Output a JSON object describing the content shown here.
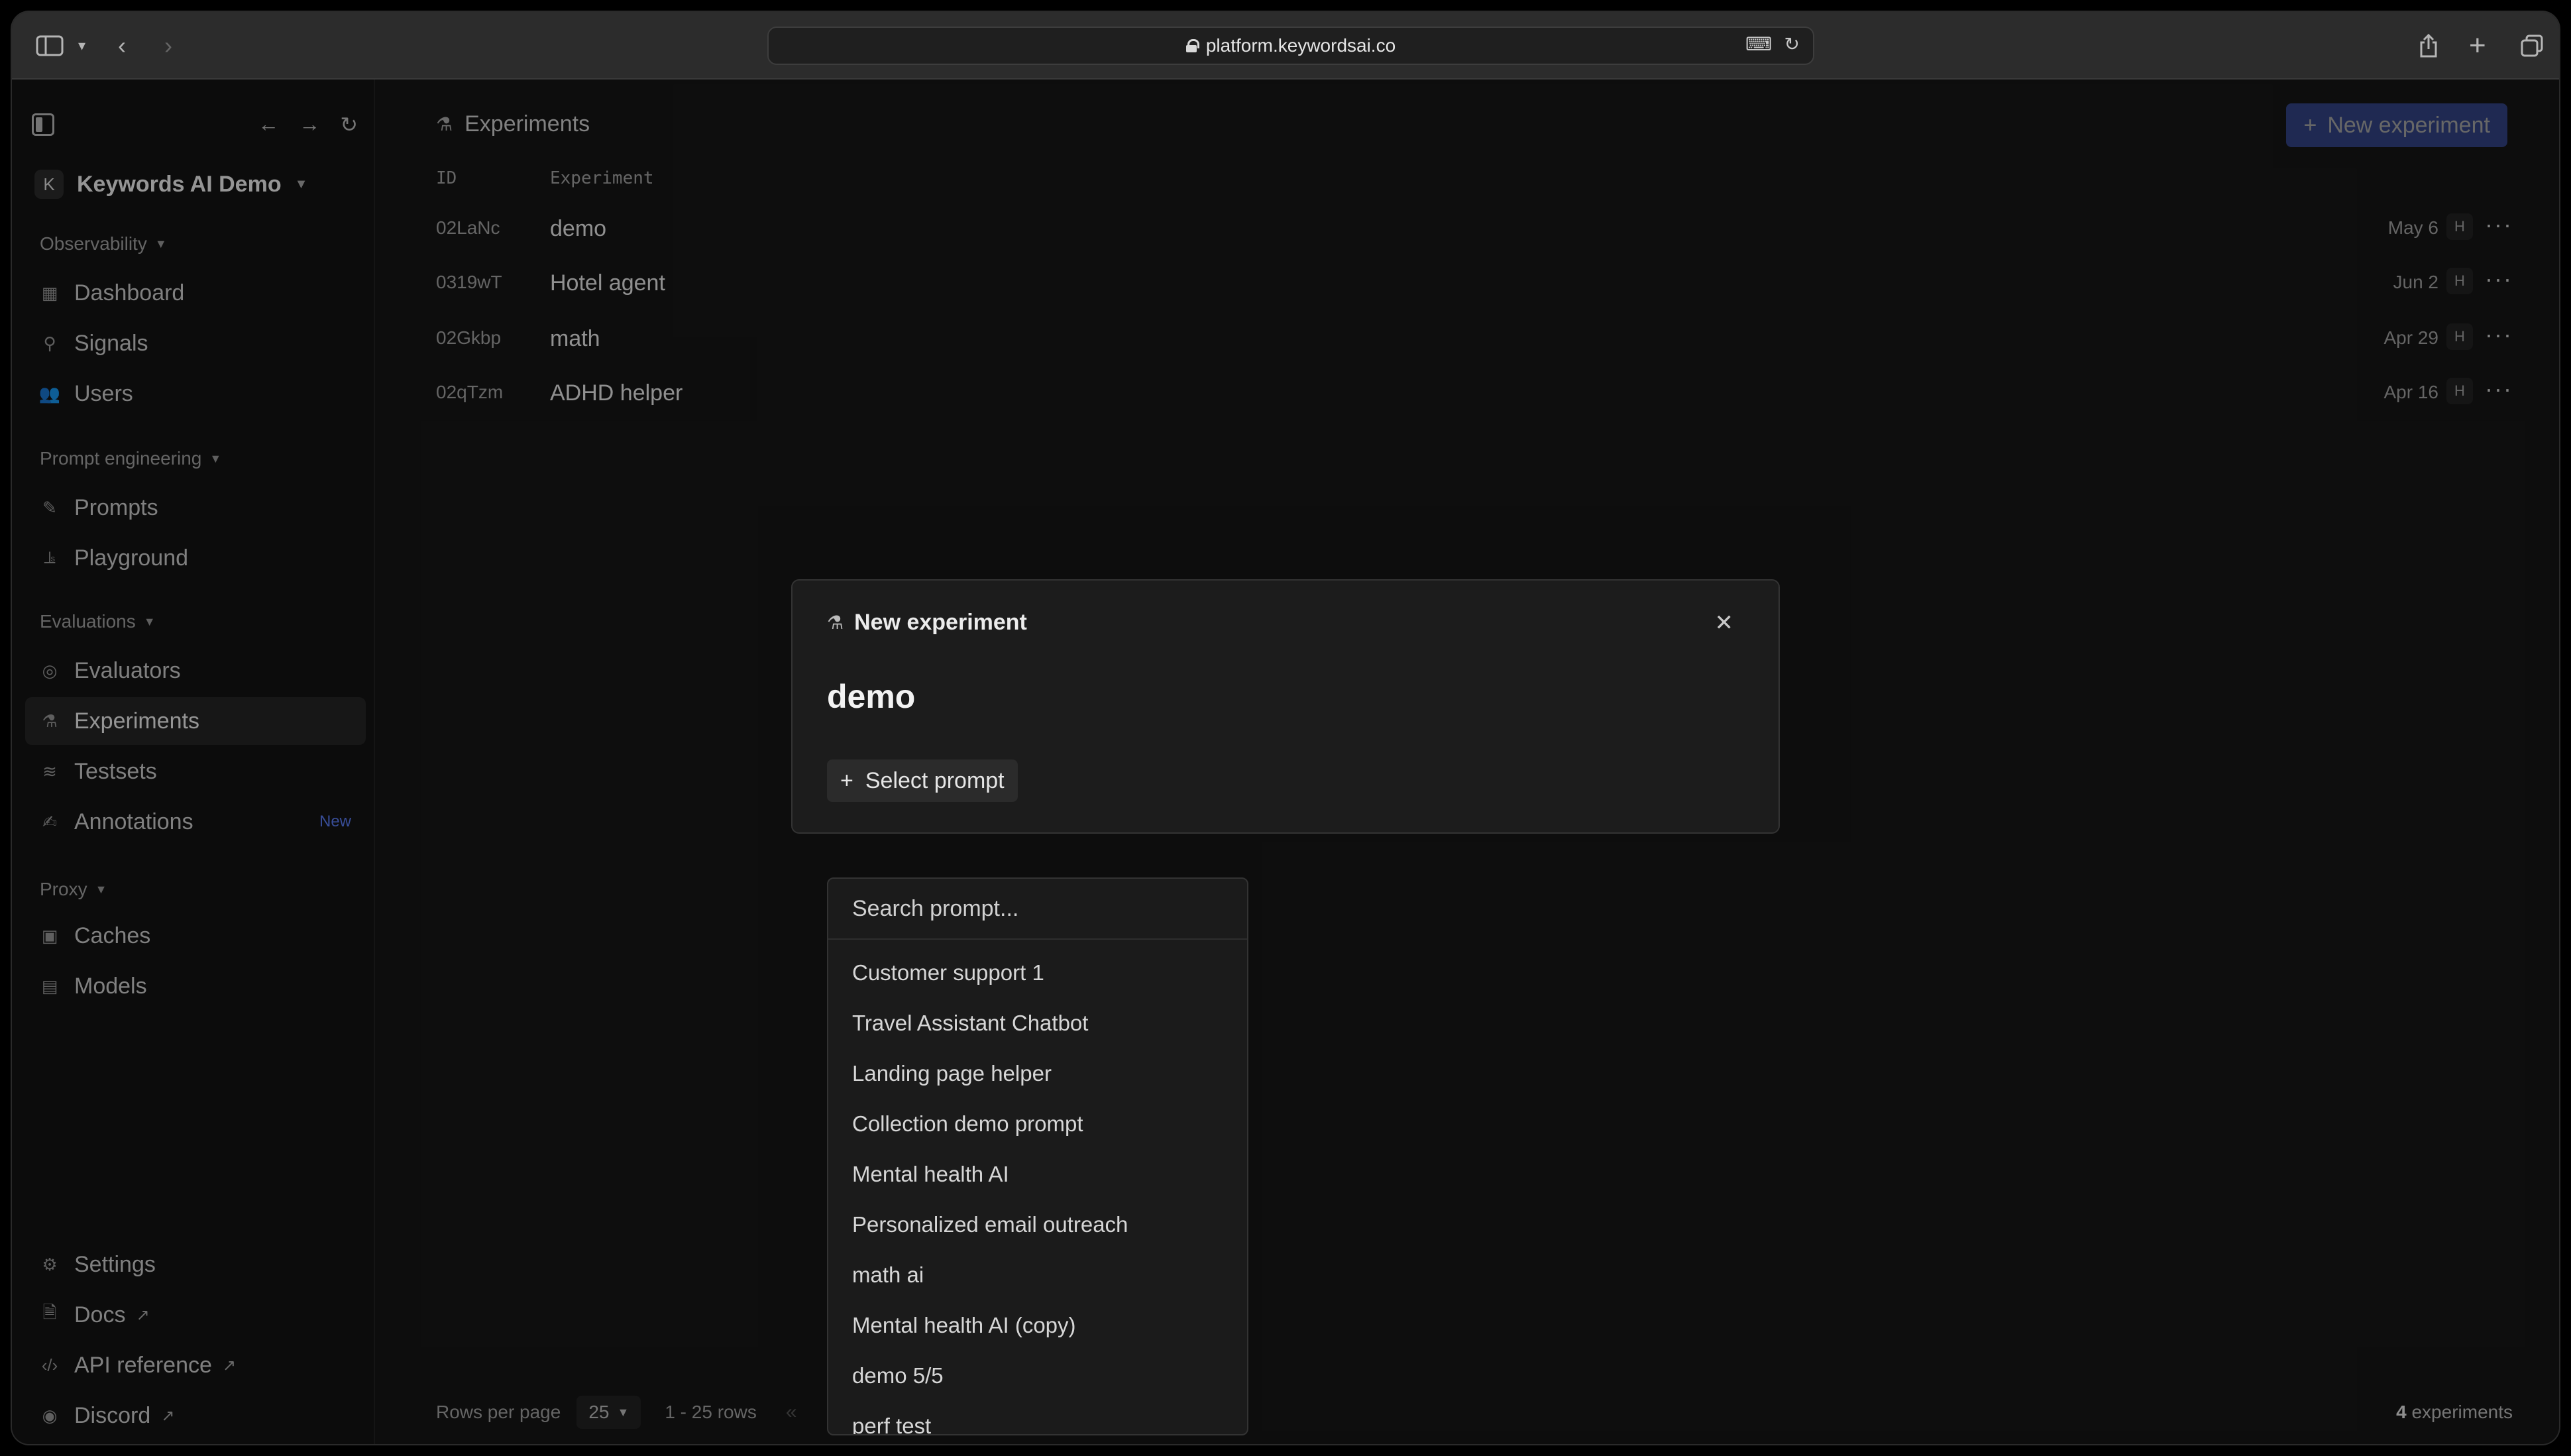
{
  "browser": {
    "url": "platform.keywordsai.co"
  },
  "sidebar": {
    "org_initial": "K",
    "org_name": "Keywords AI Demo",
    "sections": {
      "observability": "Observability",
      "prompt_engineering": "Prompt engineering",
      "evaluations": "Evaluations",
      "proxy": "Proxy"
    },
    "items": {
      "dashboard": "Dashboard",
      "signals": "Signals",
      "users": "Users",
      "prompts": "Prompts",
      "playground": "Playground",
      "evaluators": "Evaluators",
      "experiments": "Experiments",
      "testsets": "Testsets",
      "annotations": "Annotations",
      "annotations_badge": "New",
      "caches": "Caches",
      "models": "Models",
      "settings": "Settings",
      "docs": "Docs",
      "api_reference": "API reference",
      "discord": "Discord"
    }
  },
  "main": {
    "title": "Experiments",
    "new_button": "New experiment",
    "columns": {
      "id": "ID",
      "experiment": "Experiment"
    },
    "rows": [
      {
        "id": "02LaNc",
        "name": "demo",
        "date": "May 6",
        "h": "H"
      },
      {
        "id": "0319wT",
        "name": "Hotel agent",
        "date": "Jun 2",
        "h": "H"
      },
      {
        "id": "02Gkbp",
        "name": "math",
        "date": "Apr 29",
        "h": "H"
      },
      {
        "id": "02qTzm",
        "name": "ADHD helper",
        "date": "Apr 16",
        "h": "H"
      }
    ],
    "footer": {
      "rows_per_page_label": "Rows per page",
      "rows_per_page_value": "25",
      "range": "1 - 25 rows",
      "count_number": "4",
      "count_label": "experiments"
    }
  },
  "modal": {
    "title": "New experiment",
    "name": "demo",
    "select_prompt": "Select prompt"
  },
  "dropdown": {
    "search_placeholder": "Search prompt...",
    "options": [
      "Customer support 1",
      "Travel Assistant Chatbot",
      "Landing page helper",
      "Collection demo prompt",
      "Mental health AI",
      "Personalized email outreach",
      "math ai",
      "Mental health AI (copy)",
      "demo 5/5",
      "perf test"
    ]
  }
}
